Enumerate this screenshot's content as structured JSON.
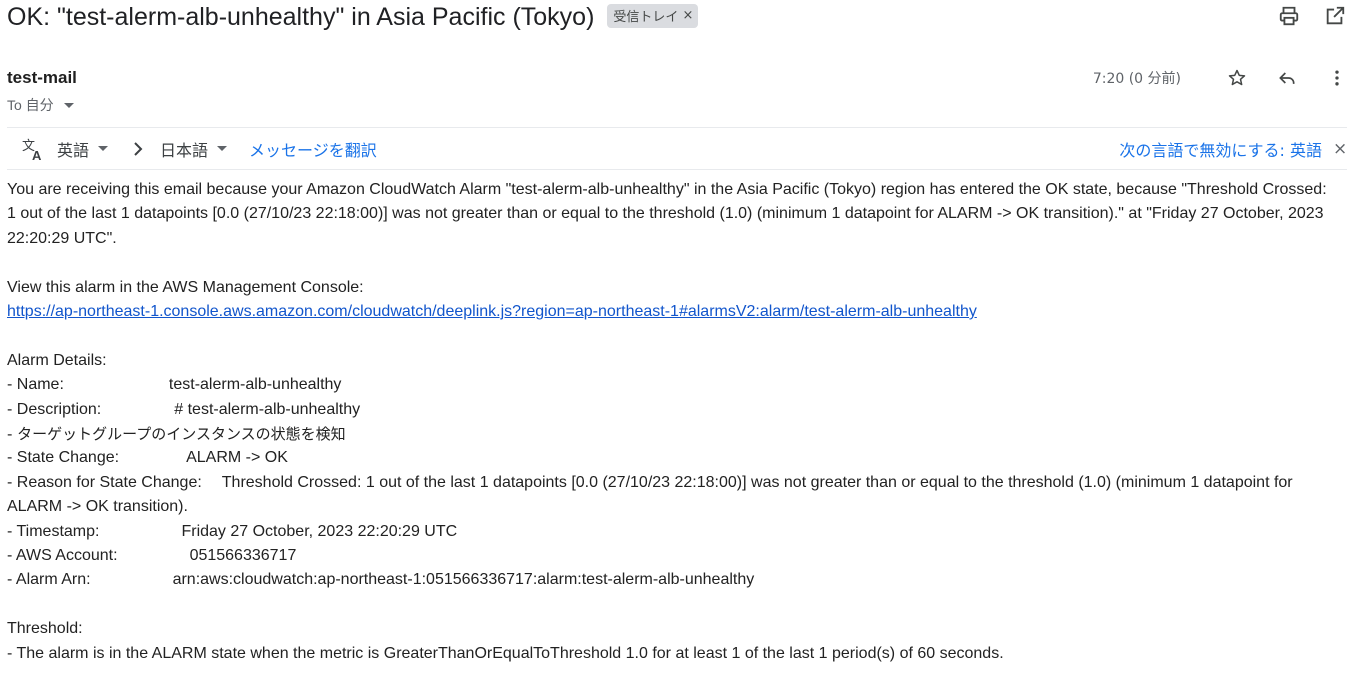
{
  "header": {
    "subject": "OK: \"test-alerm-alb-unhealthy\" in Asia Pacific (Tokyo)",
    "label": "受信トレイ",
    "label_remove": "×",
    "icons": [
      "print-icon",
      "open-in-new-window-icon"
    ]
  },
  "message": {
    "sender": "test-mail",
    "to_label": "To 自分",
    "time": "7:20 (0 分前)",
    "icons": [
      "star-icon",
      "reply-icon",
      "more-vertical-icon"
    ]
  },
  "translate": {
    "source_lang": "英語",
    "target_lang": "日本語",
    "translate_link": "メッセージを翻訳",
    "disable_link": "次の言語で無効にする: 英語",
    "close": "×",
    "icons": [
      "translate-icon",
      "chevron-right-icon"
    ]
  },
  "body": {
    "intro": "You are receiving this email because your Amazon CloudWatch Alarm \"test-alerm-alb-unhealthy\" in the Asia Pacific (Tokyo) region has entered the OK state, because \"Threshold Crossed: 1 out of the last 1 datapoints [0.0 (27/10/23 22:18:00)] was not greater than or equal to the threshold (1.0) (minimum 1 datapoint for ALARM -> OK transition).\" at \"Friday 27 October, 2023 22:20:29 UTC\".",
    "console_label": "View this alarm in the AWS Management Console:",
    "console_link": "https://ap-northeast-1.console.aws.amazon.com/cloudwatch/deeplink.js?region=ap-northeast-1#alarmsV2:alarm/test-alerm-alb-unhealthy",
    "details_heading": "Alarm Details:",
    "details": {
      "name_key": "- Name:",
      "name_val": "test-alerm-alb-unhealthy",
      "desc_key": "- Description:",
      "desc_val": "# test-alerm-alb-unhealthy",
      "desc_line2": "- ターゲットグループのインスタンスの状態を検知",
      "state_key": "- State Change:",
      "state_val": "ALARM -> OK",
      "reason_key": "- Reason for State Change:",
      "reason_val": "Threshold Crossed: 1 out of the last 1 datapoints [0.0 (27/10/23 22:18:00)] was not greater than or equal to the threshold (1.0) (minimum 1 datapoint for ALARM -> OK transition).",
      "time_key": "- Timestamp:",
      "time_val": "Friday 27 October, 2023 22:20:29 UTC",
      "account_key": "- AWS Account:",
      "account_val": "051566336717",
      "arn_key": "- Alarm Arn:",
      "arn_val": "arn:aws:cloudwatch:ap-northeast-1:051566336717:alarm:test-alerm-alb-unhealthy"
    },
    "threshold_heading": "Threshold:",
    "threshold_text": "- The alarm is in the ALARM state when the metric is GreaterThanOrEqualToThreshold 1.0 for at least 1 of the last 1 period(s) of 60 seconds."
  }
}
